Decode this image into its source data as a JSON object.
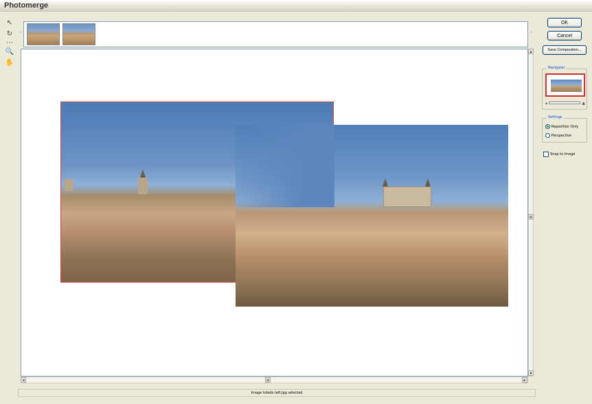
{
  "window": {
    "title": "Photomerge"
  },
  "tools": [
    {
      "name": "select-image-tool",
      "glyph": "↖"
    },
    {
      "name": "rotate-image-tool",
      "glyph": "↻"
    },
    {
      "name": "vanishing-point-tool",
      "glyph": "⋯"
    },
    {
      "name": "zoom-tool",
      "glyph": "🔍"
    },
    {
      "name": "move-view-tool",
      "glyph": "✋"
    }
  ],
  "buttons": {
    "ok": "OK",
    "cancel": "Cancel",
    "save_composition": "Save Composition..."
  },
  "navigator": {
    "legend": "Navigator"
  },
  "settings": {
    "legend": "Settings",
    "options": [
      {
        "label": "Reposition Only",
        "selected": true
      },
      {
        "label": "Perspective",
        "selected": false
      }
    ]
  },
  "snap_to_image": {
    "label": "Snap to Image",
    "checked": false
  },
  "status": {
    "text": "Image toledo-left.jpg selected"
  },
  "colors": {
    "selection_border": "#cc4444",
    "group_legend": "#0046d5",
    "button_border": "#003c74"
  }
}
